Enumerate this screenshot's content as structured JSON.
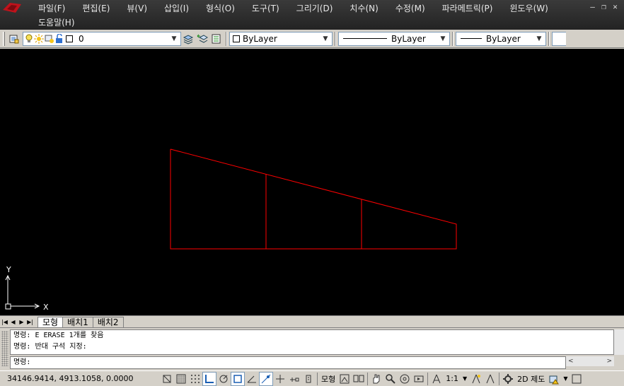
{
  "menu": {
    "row1": [
      "파일(F)",
      "편집(E)",
      "뷰(V)",
      "삽입(I)",
      "형식(O)",
      "도구(T)",
      "그리기(D)",
      "치수(N)",
      "수정(M)",
      "파라메트릭(P)",
      "윈도우(W)"
    ],
    "row2": [
      "도움말(H)"
    ]
  },
  "window_controls": [
    "–",
    "❐",
    "✕"
  ],
  "toolbar": {
    "layer_value": "0",
    "color_value": "ByLayer",
    "linetype_value": "ByLayer",
    "lineweight_value": "ByLayer"
  },
  "drawing": {
    "background": "#000000",
    "line_color": "#ff0000",
    "ucs_x_label": "X",
    "ucs_y_label": "Y"
  },
  "tabs": [
    {
      "label": "모형",
      "active": true
    },
    {
      "label": "배치1",
      "active": false
    },
    {
      "label": "배치2",
      "active": false
    }
  ],
  "command": {
    "history": [
      "명령: E ERASE 1개를 찾음",
      "명령: 반대 구석 지정:"
    ],
    "prompt": "명령:",
    "input_value": ""
  },
  "status": {
    "coordinates": "34146.9414, 4913.1058, 0.0000",
    "model_label": "모형",
    "annotation_scale": "1:1",
    "workspace": "2D 제도"
  }
}
